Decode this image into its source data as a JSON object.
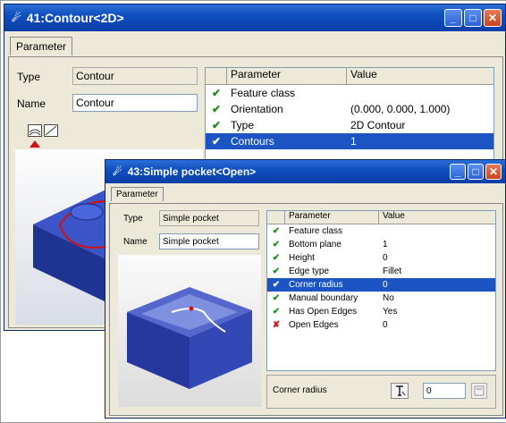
{
  "window_back": {
    "title": "41:Contour<2D>",
    "tab": "Parameter",
    "type_label": "Type",
    "type_value": "Contour",
    "name_label": "Name",
    "name_value": "Contour",
    "grid_headers": [
      "Parameter",
      "Value"
    ],
    "rows": [
      {
        "mark": "✔",
        "param": "Feature class",
        "value": ""
      },
      {
        "mark": "✔",
        "param": "Orientation",
        "value": "(0.000, 0.000, 1.000)"
      },
      {
        "mark": "✔",
        "param": "Type",
        "value": "2D Contour"
      },
      {
        "mark": "✔",
        "param": "Contours",
        "value": "1"
      }
    ],
    "selected_row": 3
  },
  "window_front": {
    "title": "43:Simple pocket<Open>",
    "tab": "Parameter",
    "type_label": "Type",
    "type_value": "Simple pocket",
    "name_label": "Name",
    "name_value": "Simple pocket",
    "grid_headers": [
      "Parameter",
      "Value"
    ],
    "rows": [
      {
        "mark": "✔",
        "param": "Feature class",
        "value": ""
      },
      {
        "mark": "✔",
        "param": "Bottom plane",
        "value": "1"
      },
      {
        "mark": "✔",
        "param": "Height",
        "value": "0"
      },
      {
        "mark": "✔",
        "param": "Edge type",
        "value": "Fillet"
      },
      {
        "mark": "✔",
        "param": "Corner radius",
        "value": "0"
      },
      {
        "mark": "✔",
        "param": "Manual boundary",
        "value": "No"
      },
      {
        "mark": "✔",
        "param": "Has Open Edges",
        "value": "Yes"
      },
      {
        "mark": "✘",
        "param": "Open Edges",
        "value": "0"
      }
    ],
    "selected_row": 4,
    "bottom_label": "Corner radius",
    "bottom_value": "0"
  },
  "colors": {
    "selection": "#1c55c3",
    "check": "#1d8a1d",
    "cross": "#d01010",
    "title_bar": "#0f4fbf",
    "model_blue": "#2f49b8"
  },
  "icons": [
    "window-icon",
    "minimize-icon",
    "maximize-icon",
    "close-icon",
    "pick-icon",
    "calculator-icon"
  ]
}
